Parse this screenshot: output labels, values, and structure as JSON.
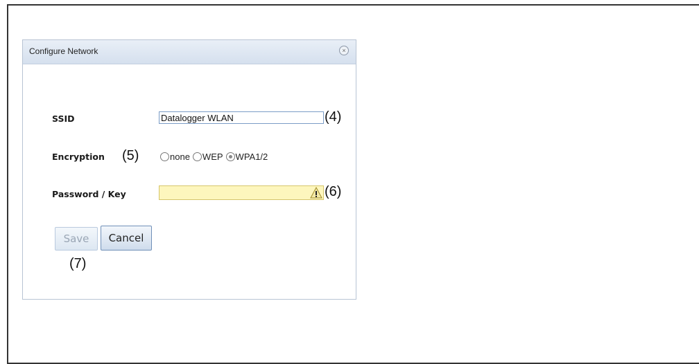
{
  "dialog": {
    "title": "Configure Network",
    "close_glyph": "×"
  },
  "fields": {
    "ssid_label": "SSID",
    "ssid_value": "Datalogger WLAN",
    "encryption_label": "Encryption",
    "encryption_options": [
      "none",
      "WEP",
      "WPA1/2"
    ],
    "encryption_selected": "WPA1/2",
    "password_label": "Password / Key",
    "password_value": ""
  },
  "buttons": {
    "save": "Save",
    "cancel": "Cancel"
  },
  "callouts": {
    "ssid": "(4)",
    "encryption": "(5)",
    "password": "(6)",
    "save": "(7)"
  },
  "icons": {
    "close": "close-icon",
    "warning": "warning-icon"
  },
  "colors": {
    "password_field_bg": "#fdf6bd",
    "titlebar": "#d5e0ee"
  }
}
